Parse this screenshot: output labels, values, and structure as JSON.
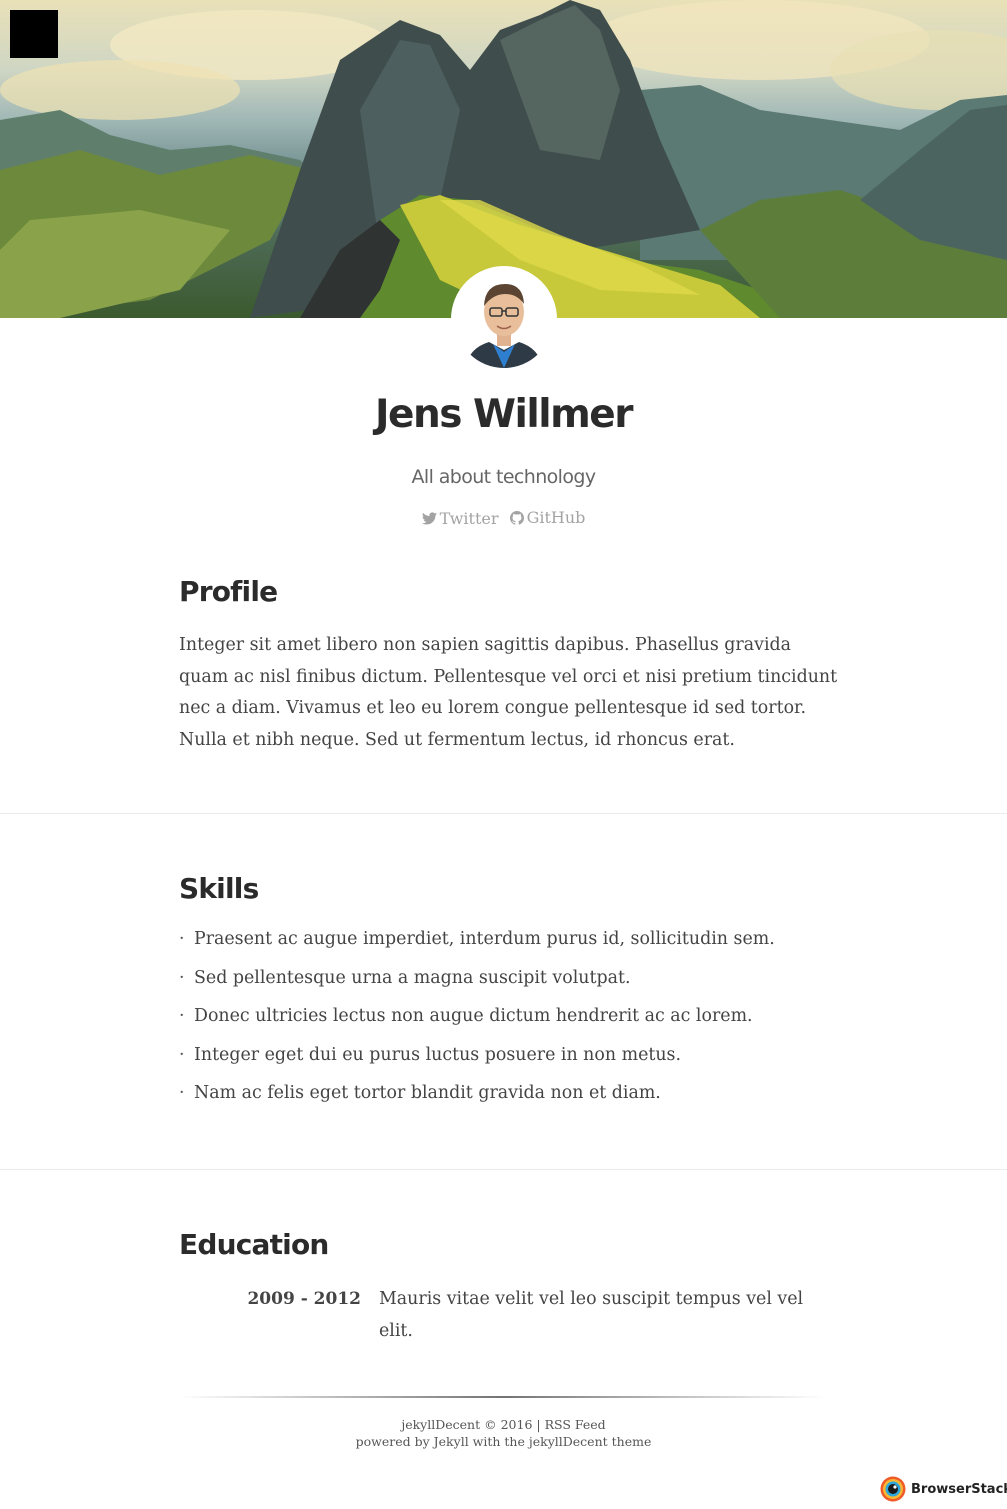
{
  "header": {
    "menu_button": "menu-icon",
    "name": "Jens Willmer",
    "tagline": "All about technology",
    "social": [
      {
        "label": "Twitter",
        "icon": "twitter-icon"
      },
      {
        "label": "GitHub",
        "icon": "github-icon"
      }
    ]
  },
  "profile": {
    "heading": "Profile",
    "text": "Integer sit amet libero non sapien sagittis dapibus. Phasellus gravida quam ac nisl finibus dictum. Pellentesque vel orci et nisi pretium tincidunt nec a diam. Vivamus et leo eu lorem congue pellentesque id sed tortor. Nulla et nibh neque. Sed ut fermentum lectus, id rhoncus erat."
  },
  "skills": {
    "heading": "Skills",
    "items": [
      "Praesent ac augue imperdiet, interdum purus id, sollicitudin sem.",
      "Sed pellentesque urna a magna suscipit volutpat.",
      "Donec ultricies lectus non augue dictum hendrerit ac ac lorem.",
      "Integer eget dui eu purus luctus posuere in non metus.",
      "Nam ac felis eget tortor blandit gravida non et diam."
    ]
  },
  "education": {
    "heading": "Education",
    "entries": [
      {
        "years": "2009 - 2012",
        "description": "Mauris vitae velit vel leo suscipit tempus vel vel elit."
      }
    ]
  },
  "footer": {
    "brand": "jekyllDecent",
    "copyright": "© 2016",
    "separator": "|",
    "rss": "RSS Feed",
    "powered": "powered by Jekyll with the jekyllDecent theme"
  },
  "badge": {
    "label": "BrowserStack"
  },
  "colors": {
    "heading": "#2b2b2b",
    "body": "#444444",
    "muted": "#a3a3a3"
  }
}
